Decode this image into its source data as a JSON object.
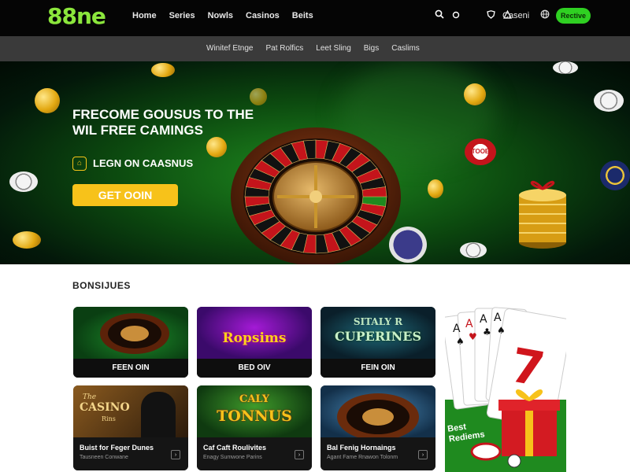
{
  "brand": {
    "logo": "88ne"
  },
  "nav": {
    "items": [
      "Home",
      "Series",
      "Nowls",
      "Casinos",
      "Beits"
    ]
  },
  "topbar": {
    "casino_label": "Caseni",
    "join_label": "Rective"
  },
  "subnav": {
    "items": [
      "Winitef Etnge",
      "Pat Rolfics",
      "Leet Sling",
      "Bigs",
      "Caslims"
    ]
  },
  "hero": {
    "title": "FRECOME GOUSUS TO THE WIL FREE CAMINGS",
    "subtitle": "LEGN ON CAASNUS",
    "cta": "GET OOIN",
    "chip_text": "TOOE"
  },
  "bonuses": {
    "section_title": "BONSIJUES",
    "row1": [
      {
        "label": "FEEN OIN"
      },
      {
        "label": "BED OIV",
        "art_title": "Ropsims"
      },
      {
        "label": "FEIN OIN",
        "art_title_top": "SITALY R",
        "art_title": "CUPERINES"
      }
    ],
    "row2": [
      {
        "title": "Buist for Feger Dunes",
        "subtitle": "Tausneen Conwane",
        "art_title_top": "The",
        "art_title": "CASINO",
        "art_sub": "Rins"
      },
      {
        "title": "Caf Caft Roulivites",
        "subtitle": "Enagy Sumwone Parins",
        "art_title_top": "CALY",
        "art_title": "TONNUS"
      },
      {
        "title": "Bal Fenig Hornaings",
        "subtitle": "Agant Fame Rnawon Tolonm"
      }
    ],
    "promo_text": "Best Rediems"
  },
  "colors": {
    "accent_green": "#2fd022",
    "cta_yellow": "#f7c21a",
    "logo_green": "#8be63c"
  }
}
